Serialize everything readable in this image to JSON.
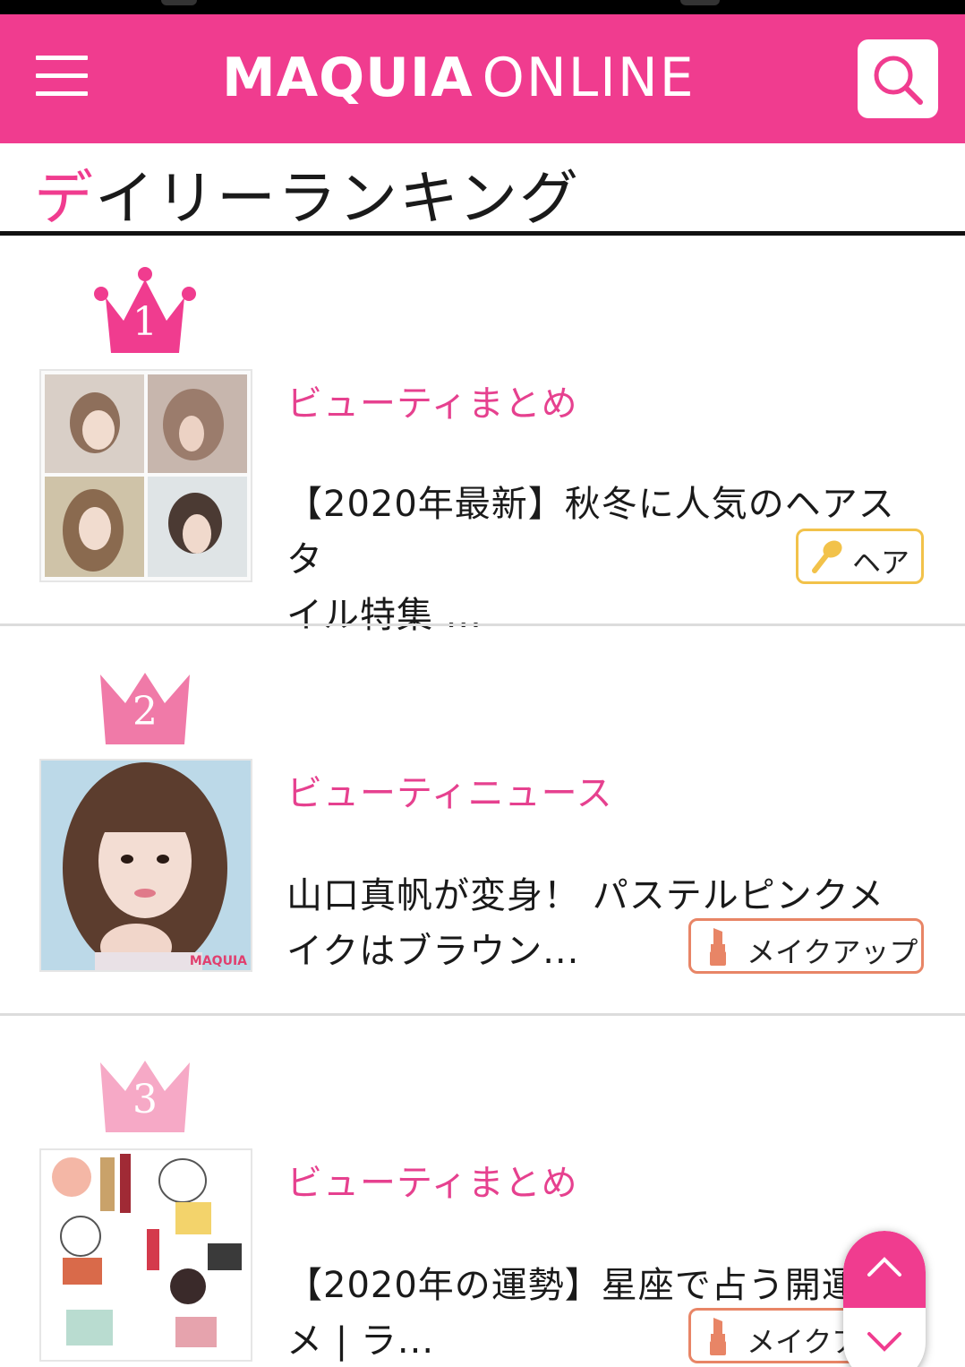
{
  "header": {
    "logo_bold": "MAQUIA",
    "logo_light": "ONLINE",
    "brand_color": "#f03c8f",
    "menu_icon": "hamburger-menu-icon",
    "search_icon": "search-icon"
  },
  "section": {
    "title_first": "デ",
    "title_rest": "イリーランキング"
  },
  "ranking": [
    {
      "rank": "1",
      "crown_color": "#f03c8f",
      "category": "ビューティまとめ",
      "headline_line1": "【2020年最新】秋冬に人気のヘアスタ",
      "headline_line2": "イル特集 ...",
      "tag_label": "ヘア",
      "tag_icon": "hairbrush-icon",
      "tag_color": "#f2c24a"
    },
    {
      "rank": "2",
      "crown_color": "#f07aa8",
      "category": "ビューティニュース",
      "headline_line1": "山口真帆が変身！ パステルピンクメ",
      "headline_line2": "イクはブラウン...",
      "tag_label": "メイクアップ",
      "tag_icon": "lipstick-icon",
      "tag_color": "#e88566",
      "thumb_watermark": "MAQUIA"
    },
    {
      "rank": "3",
      "crown_color": "#f6a9c6",
      "category": "ビューティまとめ",
      "headline_line1": "【2020年の運勢】星座で占う開運",
      "headline_line2": "メ | ラ...",
      "tag_label": "メイクア",
      "tag_icon": "lipstick-icon",
      "tag_color": "#e88566"
    }
  ],
  "scroll_controls": {
    "up_icon": "chevron-up-icon",
    "down_icon": "chevron-down-icon"
  }
}
